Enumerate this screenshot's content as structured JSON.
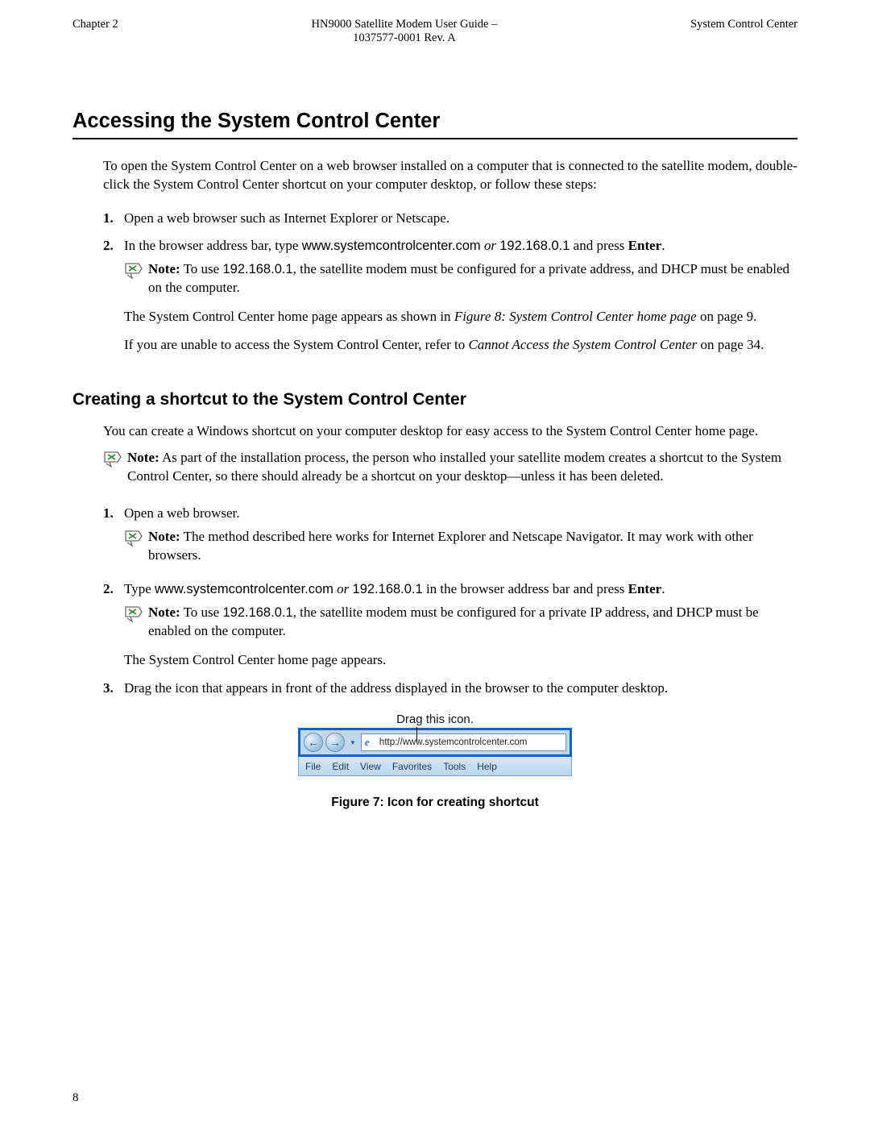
{
  "header": {
    "left": "Chapter 2",
    "center_l1": "HN9000 Satellite Modem User Guide –",
    "center_l2": "1037577-0001 Rev. A",
    "right": "System Control Center"
  },
  "h1": "Accessing the System Control Center",
  "intro": "To open the System Control Center on a web browser installed on a computer that is connected to the satellite modem, double-click the System Control Center shortcut on your computer desktop, or follow these steps:",
  "steps1": {
    "s1": {
      "num": "1.",
      "text": "Open a web browser such as Internet Explorer or Netscape."
    },
    "s2": {
      "num": "2.",
      "pre": "In the browser address bar, type ",
      "url": "www.systemcontrolcenter.com",
      "or": " or ",
      "ip": "192.168.0.1",
      "post": " and press ",
      "enter": "Enter",
      "dot": ".",
      "note_label": "Note:",
      "note_pre": "  To use ",
      "note_ip": "192.168.0.1",
      "note_post": ", the satellite modem must be configured for a private address, and DHCP must be enabled on the computer.",
      "follow1_pre": "The System Control Center home page appears as shown in ",
      "follow1_link": "Figure 8: System Control Center home page",
      "follow1_post": " on page 9.",
      "follow2_pre": "If you are unable to access the System Control Center, refer to ",
      "follow2_link": "Cannot Access the System Control Center",
      "follow2_post": " on page 34."
    }
  },
  "h2": "Creating a shortcut to the System Control Center",
  "sec_intro": "You can create a Windows shortcut on your computer desktop for easy access to the System Control Center home page.",
  "sec_note": {
    "label": "Note:",
    "text": "  As part of the installation process, the person who installed your satellite modem creates a shortcut to the System Control Center, so there should already be a shortcut on your desktop—unless it has been deleted."
  },
  "steps2": {
    "s1": {
      "num": "1.",
      "text": "Open a web browser.",
      "note_label": "Note:",
      "note_text": "  The method described here works for Internet Explorer and Netscape Navigator. It may work with other browsers."
    },
    "s2": {
      "num": "2.",
      "pre": "Type ",
      "url": "www.systemcontrolcenter.com",
      "or": " or ",
      "ip": "192.168.0.1",
      "post": " in the browser address bar and press ",
      "enter": "Enter",
      "dot": ".",
      "note_label": "Note:",
      "note_pre": "  To use ",
      "note_ip": "192.168.0.1",
      "note_post": ", the satellite modem must be configured for a private IP address, and DHCP must be enabled on the computer.",
      "follow": "The System Control Center home page appears."
    },
    "s3": {
      "num": "3.",
      "text": "Drag the icon that appears in front of the address displayed in the browser to the computer desktop."
    }
  },
  "figure": {
    "drag_label": "Drag this icon.",
    "url": "http://www.systemcontrolcenter.com",
    "menu": {
      "file": "File",
      "edit": "Edit",
      "view": "View",
      "fav": "Favorites",
      "tools": "Tools",
      "help": "Help"
    },
    "caption": "Figure 7: Icon for creating shortcut",
    "back_glyph": "←",
    "fwd_glyph": "→",
    "caret_glyph": "▼",
    "ie_glyph": "e"
  },
  "page_number": "8"
}
